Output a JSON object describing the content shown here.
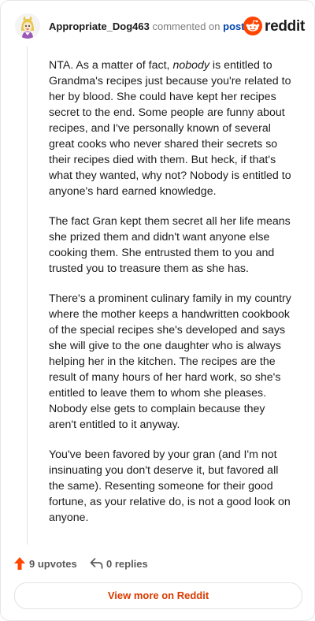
{
  "header": {
    "username": "Appropriate_Dog463",
    "commented_text": "commented on",
    "post_link": "post",
    "brand": "reddit"
  },
  "comment": {
    "paragraphs": [
      {
        "pre": "NTA. As a matter of fact, ",
        "em": "nobody",
        "post": " is entitled to Grandma's recipes just because you're related to her by blood. She could have kept her recipes secret to the end. Some people are funny about recipes, and I've personally known of several great cooks who never shared their secrets so their recipes died with them. But heck, if that's what they wanted, why not? Nobody is entitled to anyone's hard earned knowledge."
      },
      {
        "text": "The fact Gran kept them secret all her life means she prized them and didn't want anyone else cooking them. She entrusted them to you and trusted you to treasure them as she has."
      },
      {
        "text": "There's a prominent culinary family in my country where the mother keeps a handwritten cookbook of the special recipes she's developed and says she will give to the one daughter who is always helping her in the kitchen. The recipes are the result of many hours of her hard work, so she's entitled to leave them to whom she pleases. Nobody else gets to complain because they aren't entitled to it anyway."
      },
      {
        "text": "You've been favored by your gran (and I'm not insinuating you don't deserve it, but favored all the same). Resenting someone for their good fortune, as your relative do, is not a good look on anyone."
      }
    ]
  },
  "footer": {
    "upvotes": "9 upvotes",
    "replies": "0 replies"
  },
  "cta": {
    "label": "View more on Reddit"
  },
  "colors": {
    "brand_orange": "#ff4500",
    "link_blue": "#0045ac",
    "cta_text": "#d93a00",
    "upvote_arrow": "#ff4500"
  },
  "icons": [
    "avatar",
    "reddit-logo-icon",
    "upvote-arrow-icon",
    "reply-arrow-icon"
  ]
}
